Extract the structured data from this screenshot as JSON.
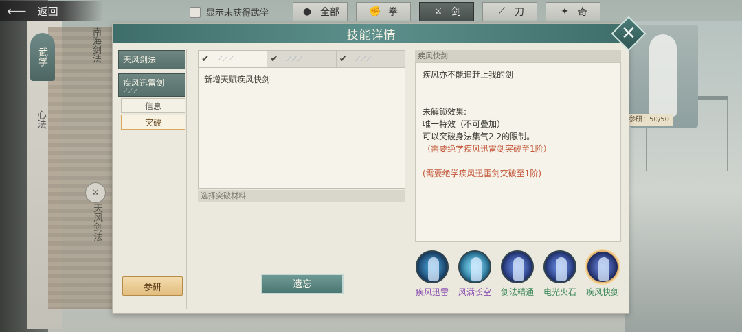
{
  "topbar": {
    "back_label": "返回",
    "show_unobtained_label": "显示未获得武学",
    "filters": [
      {
        "label": "全部",
        "icon": "bag-icon",
        "active": false
      },
      {
        "label": "拳",
        "icon": "fist-icon",
        "active": false
      },
      {
        "label": "剑",
        "icon": "sword-icon",
        "active": true
      },
      {
        "label": "刀",
        "icon": "blade-icon",
        "active": false
      },
      {
        "label": "奇",
        "icon": "shuriken-icon",
        "active": false
      }
    ]
  },
  "background": {
    "nav_wuxue": "武学",
    "nav_xinfa": "心法",
    "card_title": "南海剑法",
    "side_skill": "天风剑法",
    "research_tag": "参研：50/50"
  },
  "dialog": {
    "title": "技能详情",
    "left": {
      "skill_main": "天风剑法",
      "skill_sub": "疾风迅雷剑",
      "skill_sub_pips": "⟋⟋⟋",
      "tab_info": "信息",
      "tab_break": "突破",
      "research_label": "参研"
    },
    "middle": {
      "break_tabs": [
        {
          "check": "✔",
          "swords": "⟋⟋⟋",
          "active": true
        },
        {
          "check": "✔",
          "swords": "⟋⟋⟋",
          "active": false
        },
        {
          "check": "✔",
          "swords": "⟋⟋⟋",
          "active": false
        }
      ],
      "break_desc": "新增天赋疾风快剑",
      "materials_label": "选择突破材料",
      "forget_label": "遗忘"
    },
    "right": {
      "detail_title": "疾风快剑",
      "line1": "疾风亦不能追赶上我的剑",
      "unlock_header": "未解锁效果:",
      "effect1": "唯一特效（不可叠加）",
      "effect2": "可以突破身法集气2.2的限制。",
      "req1": "（需要绝学疾风迅雷剑突破至1阶）",
      "req2": "(需要绝学疾风迅雷剑突破至1阶)",
      "skills": [
        {
          "label": "疾风迅雷",
          "color": "#8a4fb0",
          "orb": "#1f4d7a"
        },
        {
          "label": "风满长空",
          "color": "#8a4fb0",
          "orb": "#2a7da6"
        },
        {
          "label": "剑法精通",
          "color": "#3f8a5a",
          "orb": "#2a3f8a"
        },
        {
          "label": "电光火石",
          "color": "#3f8a5a",
          "orb": "#2a3f8a"
        },
        {
          "label": "疾风快剑",
          "color": "#3f8a5a",
          "orb": "#27377a"
        }
      ]
    }
  }
}
